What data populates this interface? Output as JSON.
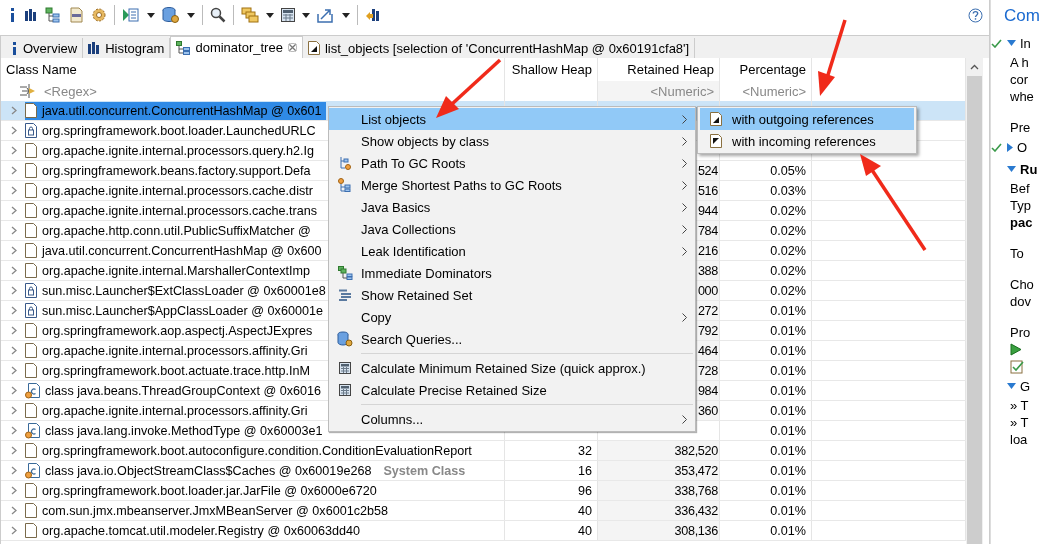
{
  "tabs": [
    {
      "label": "Overview",
      "kind": "info",
      "selected": false,
      "closable": false
    },
    {
      "label": "Histogram",
      "kind": "bars",
      "selected": false,
      "closable": false
    },
    {
      "label": "dominator_tree",
      "kind": "tree",
      "selected": true,
      "closable": true
    },
    {
      "label": "list_objects [selection of 'ConcurrentHashMap @ 0x60191cfa8']",
      "kind": "doc",
      "selected": false,
      "closable": false
    }
  ],
  "table": {
    "columns": [
      {
        "label": "Class Name",
        "filter": "<Regex>"
      },
      {
        "label": "Shallow Heap"
      },
      {
        "label": "Retained Heap",
        "filter": "<Numeric>"
      },
      {
        "label": "Percentage",
        "filter": "<Numeric>"
      }
    ],
    "rows": [
      {
        "name": "java.util.concurrent.ConcurrentHashMap @ 0x601",
        "kind": "object",
        "selected": true
      },
      {
        "name": "org.springframework.boot.loader.LaunchedURLC",
        "kind": "classloader",
        "selected": false
      },
      {
        "name": "org.apache.ignite.internal.processors.query.h2.Ig",
        "kind": "object",
        "selected": false
      },
      {
        "name": "org.springframework.beans.factory.support.Defa",
        "kind": "object",
        "selected": false,
        "retained": "524",
        "percentage": "0.05%"
      },
      {
        "name": "org.apache.ignite.internal.processors.cache.distr",
        "kind": "object",
        "selected": false,
        "retained": "516",
        "percentage": "0.03%"
      },
      {
        "name": "org.apache.ignite.internal.processors.cache.trans",
        "kind": "object",
        "selected": false,
        "retained": "944",
        "percentage": "0.02%"
      },
      {
        "name": "org.apache.http.conn.util.PublicSuffixMatcher @",
        "kind": "object",
        "selected": false,
        "retained": "784",
        "percentage": "0.02%"
      },
      {
        "name": "java.util.concurrent.ConcurrentHashMap @ 0x600",
        "kind": "object",
        "selected": false,
        "retained": "216",
        "percentage": "0.02%"
      },
      {
        "name": "org.apache.ignite.internal.MarshallerContextImp",
        "kind": "object",
        "selected": false,
        "retained": "388",
        "percentage": "0.02%"
      },
      {
        "name": "sun.misc.Launcher$ExtClassLoader @ 0x60001e8",
        "kind": "classloader",
        "selected": false,
        "retained": "000",
        "percentage": "0.02%"
      },
      {
        "name": "sun.misc.Launcher$AppClassLoader @ 0x60001e",
        "kind": "classloader",
        "selected": false,
        "retained": "272",
        "percentage": "0.01%"
      },
      {
        "name": "org.springframework.aop.aspectj.AspectJExpres",
        "kind": "object",
        "selected": false,
        "retained": "792",
        "percentage": "0.01%"
      },
      {
        "name": "org.apache.ignite.internal.processors.affinity.Gri",
        "kind": "object",
        "selected": false,
        "retained": "464",
        "percentage": "0.01%"
      },
      {
        "name": "org.springframework.boot.actuate.trace.http.InM",
        "kind": "object",
        "selected": false,
        "retained": "728",
        "percentage": "0.01%"
      },
      {
        "name": "class java.beans.ThreadGroupContext @ 0x6016",
        "kind": "class",
        "selected": false,
        "retained": "984",
        "percentage": "0.01%"
      },
      {
        "name": "org.apache.ignite.internal.processors.affinity.Gri",
        "kind": "object",
        "selected": false,
        "retained": "360",
        "percentage": "0.01%"
      },
      {
        "name": "class java.lang.invoke.MethodType @ 0x60003e1",
        "kind": "class",
        "selected": false,
        "percentage": "0.01%"
      },
      {
        "name": "org.springframework.boot.autoconfigure.condition.ConditionEvaluationReport",
        "kind": "object",
        "selected": false,
        "shallow": "32",
        "retained": "382,520",
        "percentage": "0.01%"
      },
      {
        "name": "class java.io.ObjectStreamClass$Caches @ 0x60019e268",
        "tag": "System Class",
        "kind": "class",
        "selected": false,
        "shallow": "16",
        "retained": "353,472",
        "percentage": "0.01%"
      },
      {
        "name": "org.springframework.boot.loader.jar.JarFile @ 0x6000e6720",
        "kind": "object",
        "selected": false,
        "shallow": "96",
        "retained": "338,768",
        "percentage": "0.01%"
      },
      {
        "name": "com.sun.jmx.mbeanserver.JmxMBeanServer @ 0x6001c2b58",
        "kind": "object",
        "selected": false,
        "shallow": "40",
        "retained": "336,432",
        "percentage": "0.01%"
      },
      {
        "name": "org.apache.tomcat.util.modeler.Registry @ 0x60063dd40",
        "kind": "object",
        "selected": false,
        "shallow": "40",
        "retained": "308,136",
        "percentage": "0.01%"
      }
    ]
  },
  "context_menu": {
    "items": [
      {
        "label": "List objects",
        "kind": "plain",
        "submenu": true,
        "selected": true
      },
      {
        "label": "Show objects by class",
        "kind": "plain",
        "submenu": true,
        "selected": false
      },
      {
        "label": "Path To GC Roots",
        "kind": "path",
        "submenu": true,
        "selected": false
      },
      {
        "label": "Merge Shortest Paths to GC Roots",
        "kind": "merge",
        "submenu": true,
        "selected": false
      },
      {
        "label": "Java Basics",
        "kind": "plain",
        "submenu": true,
        "selected": false
      },
      {
        "label": "Java Collections",
        "kind": "plain",
        "submenu": true,
        "selected": false
      },
      {
        "label": "Leak Identification",
        "kind": "plain",
        "submenu": true,
        "selected": false
      },
      {
        "label": "Immediate Dominators",
        "kind": "dominators",
        "submenu": false,
        "selected": false
      },
      {
        "label": "Show Retained Set",
        "kind": "retained",
        "submenu": false,
        "selected": false
      },
      {
        "label": "Copy",
        "kind": "plain",
        "submenu": true,
        "selected": false
      },
      {
        "label": "Search Queries...",
        "kind": "database",
        "submenu": false,
        "selected": false,
        "separator_after": true
      },
      {
        "label": "Calculate Minimum Retained Size (quick approx.)",
        "kind": "calculator",
        "submenu": false,
        "selected": false
      },
      {
        "label": "Calculate Precise Retained Size",
        "kind": "calculator",
        "submenu": false,
        "selected": false,
        "separator_after": true
      },
      {
        "label": "Columns...",
        "kind": "plain",
        "submenu": true,
        "selected": false
      }
    ]
  },
  "submenu": {
    "items": [
      {
        "label": "with outgoing references",
        "selected": true
      },
      {
        "label": "with incoming references",
        "selected": false
      }
    ]
  },
  "side_panel": {
    "title": "Com",
    "lines": [
      {
        "text": "In",
        "kind": "section",
        "checked": true
      },
      {
        "text": "A h",
        "kind": "text"
      },
      {
        "text": "cor",
        "kind": "text"
      },
      {
        "text": "whe",
        "kind": "text"
      },
      {
        "text": "Pre",
        "kind": "gap"
      },
      {
        "text": "O",
        "kind": "collapsed",
        "checked": true
      },
      {
        "text": "Ru",
        "kind": "heading"
      },
      {
        "text": "Bef",
        "kind": "text"
      },
      {
        "text": "Typ",
        "kind": "text"
      },
      {
        "text": "pac",
        "kind": "bold"
      },
      {
        "text": "To",
        "kind": "gap"
      },
      {
        "text": "Cho",
        "kind": "gap"
      },
      {
        "text": "dov",
        "kind": "text"
      },
      {
        "text": "Pro",
        "kind": "gap"
      },
      {
        "kind": "run"
      },
      {
        "kind": "task"
      },
      {
        "text": "G",
        "kind": "section",
        "checked": false
      },
      {
        "text": "» T",
        "kind": "text"
      },
      {
        "text": "» T",
        "kind": "text"
      },
      {
        "text": "loa",
        "kind": "text"
      }
    ]
  }
}
